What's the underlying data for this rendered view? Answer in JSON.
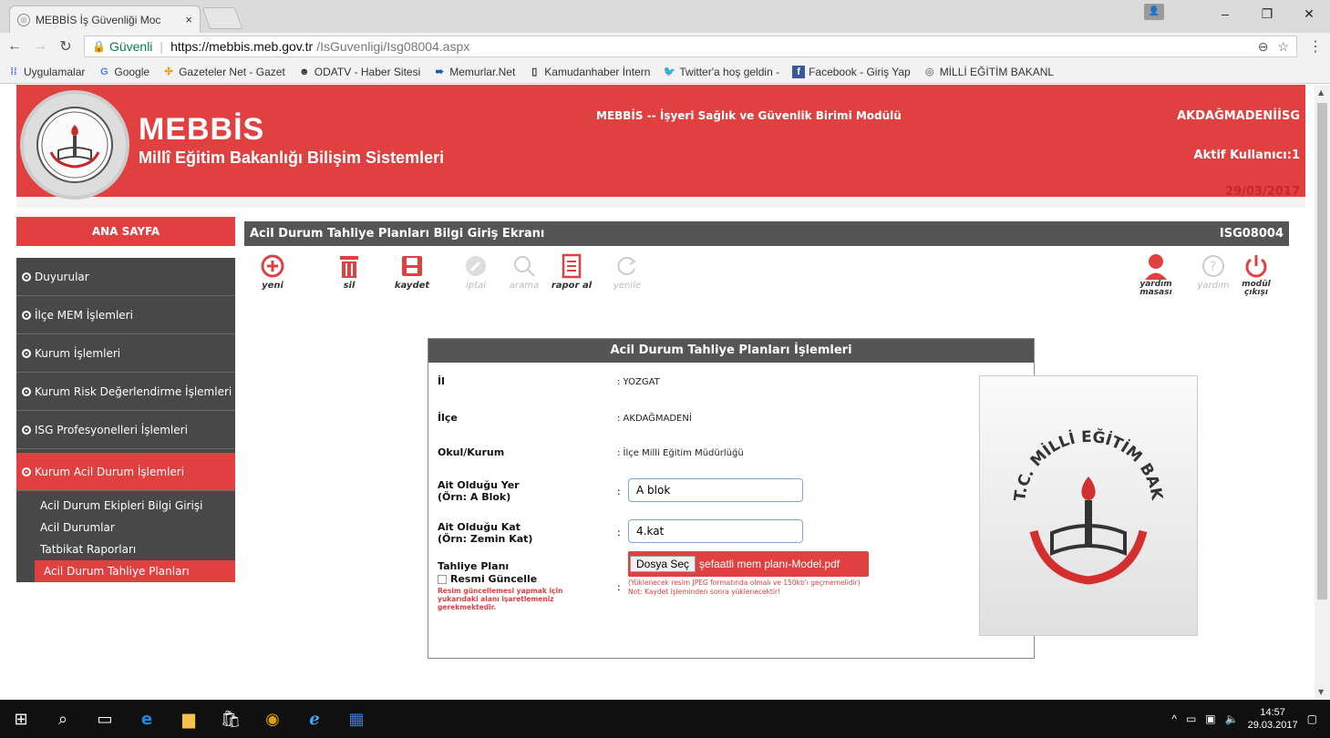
{
  "browser": {
    "tab_title": "MEBBİS İş Güvenliği Moc",
    "tab_close": "×",
    "window_buttons": [
      "–",
      "❐",
      "✕"
    ],
    "secure_label": "Güvenli",
    "url_host": "https://mebbis.meb.gov.tr",
    "url_path": "/IsGuvenligi/Isg08004.aspx",
    "bookmarks": [
      "Uygulamalar",
      "Google",
      "Gazeteler Net - Gazet",
      "ODATV - Haber Sitesi",
      "Memurlar.Net",
      "Kamudanhaber İntern",
      "Twitter'a hoş geldin -",
      "Facebook - Giriş Yap",
      "MİLLİ EĞİTİM BAKANL"
    ]
  },
  "header": {
    "brand": "MEBBİS",
    "subtitle": "Millî Eğitim Bakanlığı Bilişim Sistemleri",
    "module_title": "MEBBİS -- İşyeri Sağlık ve Güvenlik Birimi Modülü",
    "institution": "AKDAĞMADENİİSG",
    "active_user": "Aktif Kullanıcı:1",
    "date": "29/03/2017"
  },
  "sidebar": {
    "home": "ANA SAYFA",
    "items": [
      "Duyurular",
      "İlçe MEM İşlemleri",
      "Kurum İşlemleri",
      "Kurum Risk Değerlendirme İşlemleri",
      "ISG Profesyonelleri İşlemleri"
    ],
    "active_item": "Kurum Acil Durum İşlemleri",
    "subitems": [
      "Acil Durum Ekipleri Bilgi Girişi",
      "Acil Durumlar",
      "Tatbikat Raporları",
      "Acil Durum Tahliye Planları"
    ]
  },
  "content": {
    "title": "Acil Durum Tahliye Planları Bilgi Giriş Ekranı",
    "code": "ISG08004",
    "actions": {
      "new": "yeni",
      "delete": "sil",
      "save": "kaydet",
      "cancel": "iptal",
      "search": "arama",
      "report": "rapor al",
      "refresh": "yenile",
      "helpdesk": "yardım masası",
      "help": "yardım",
      "exit": "modül çıkışı"
    }
  },
  "form": {
    "title": "Acil Durum Tahliye Planları İşlemleri",
    "il_label": "İl",
    "il_value": ": YOZGAT",
    "ilce_label": "İlçe",
    "ilce_value": ": AKDAĞMADENİ",
    "okul_label": "Okul/Kurum",
    "okul_value": ": İlçe Milli Eğitim Müdürlüğü",
    "yer_label": "Ait Olduğu Yer",
    "yer_hint": "(Örn: A Blok)",
    "yer_value": "A blok",
    "kat_label": "Ait Olduğu Kat",
    "kat_hint": "(Örn: Zemin Kat)",
    "kat_value": "4.kat",
    "plan_label": "Tahliye Planı",
    "update_label": "Resmi Güncelle",
    "update_note": "Resim güncellemesi yapmak için yukarıdaki alanı işaretlemeniz gerekmektedir.",
    "file_button": "Dosya Seç",
    "file_name": "şefaatli mem planı-Model.pdf",
    "file_warn1": "(Yüklenecek resim JPEG formatında olmalı ve 150kb'ı geçmemelidir)",
    "file_warn2": "Not: Kaydet işleminden sonra yüklenecektir!"
  },
  "taskbar": {
    "time": "14:57",
    "date": "29.03.2017"
  }
}
